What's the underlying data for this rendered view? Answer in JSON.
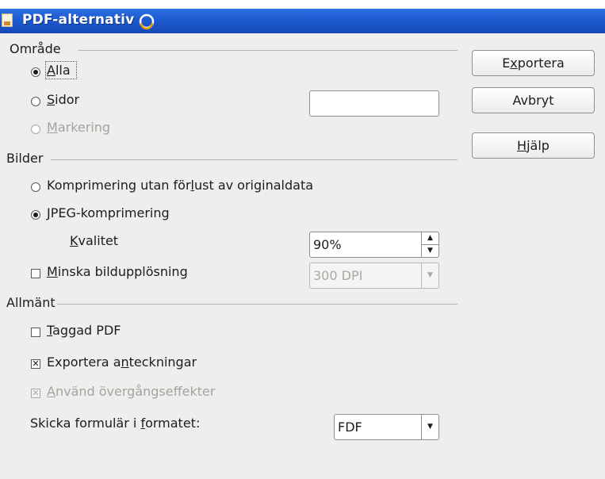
{
  "window": {
    "title": "PDF-alternativ"
  },
  "range": {
    "heading": "Område",
    "options": [
      {
        "label": "Alla",
        "mnemonic": "A",
        "rest": "lla",
        "selected": true,
        "enabled": true
      },
      {
        "label": "Sidor",
        "mnemonic": "S",
        "rest": "idor",
        "selected": false,
        "enabled": true,
        "value": ""
      },
      {
        "label": "Markering",
        "mnemonic": "M",
        "rest": "arkering",
        "selected": false,
        "enabled": false
      }
    ]
  },
  "images": {
    "heading": "Bilder",
    "lossless": {
      "pre": "Komprimering utan för",
      "mnemonic": "l",
      "post": "ust av originaldata",
      "selected": false
    },
    "jpeg": {
      "mnemonic": "J",
      "rest": "PEG-komprimering",
      "selected": true
    },
    "quality": {
      "mnemonic": "K",
      "rest": "valitet",
      "value": "90%"
    },
    "reduce": {
      "mnemonic": "M",
      "rest": "inska bildupplösning",
      "checked": false
    },
    "resolution": {
      "value": "300 DPI",
      "enabled": false
    }
  },
  "general": {
    "heading": "Allmänt",
    "tagged": {
      "mnemonic": "T",
      "rest": "aggad PDF",
      "checked": false
    },
    "notes": {
      "pre": "Exportera a",
      "mnemonic": "n",
      "post": "teckningar",
      "checked": true
    },
    "transitions": {
      "mnemonic": "A",
      "rest": "nvänd övergångseffekter",
      "checked": true,
      "enabled": false
    },
    "submit": {
      "pre": "Skicka formulär i ",
      "mnemonic": "f",
      "post": "ormatet:",
      "value": "FDF"
    }
  },
  "buttons": {
    "export": {
      "pre": "E",
      "mnemonic": "x",
      "post": "portera"
    },
    "cancel": {
      "label": "Avbryt"
    },
    "help": {
      "pre": "",
      "mnemonic": "H",
      "post": "jälp"
    }
  },
  "icons": {
    "radio": "radio-button-icon",
    "checkbox": "checkbox-icon",
    "spin_up": "▲",
    "spin_down": "▼",
    "dropdown": "▼"
  }
}
